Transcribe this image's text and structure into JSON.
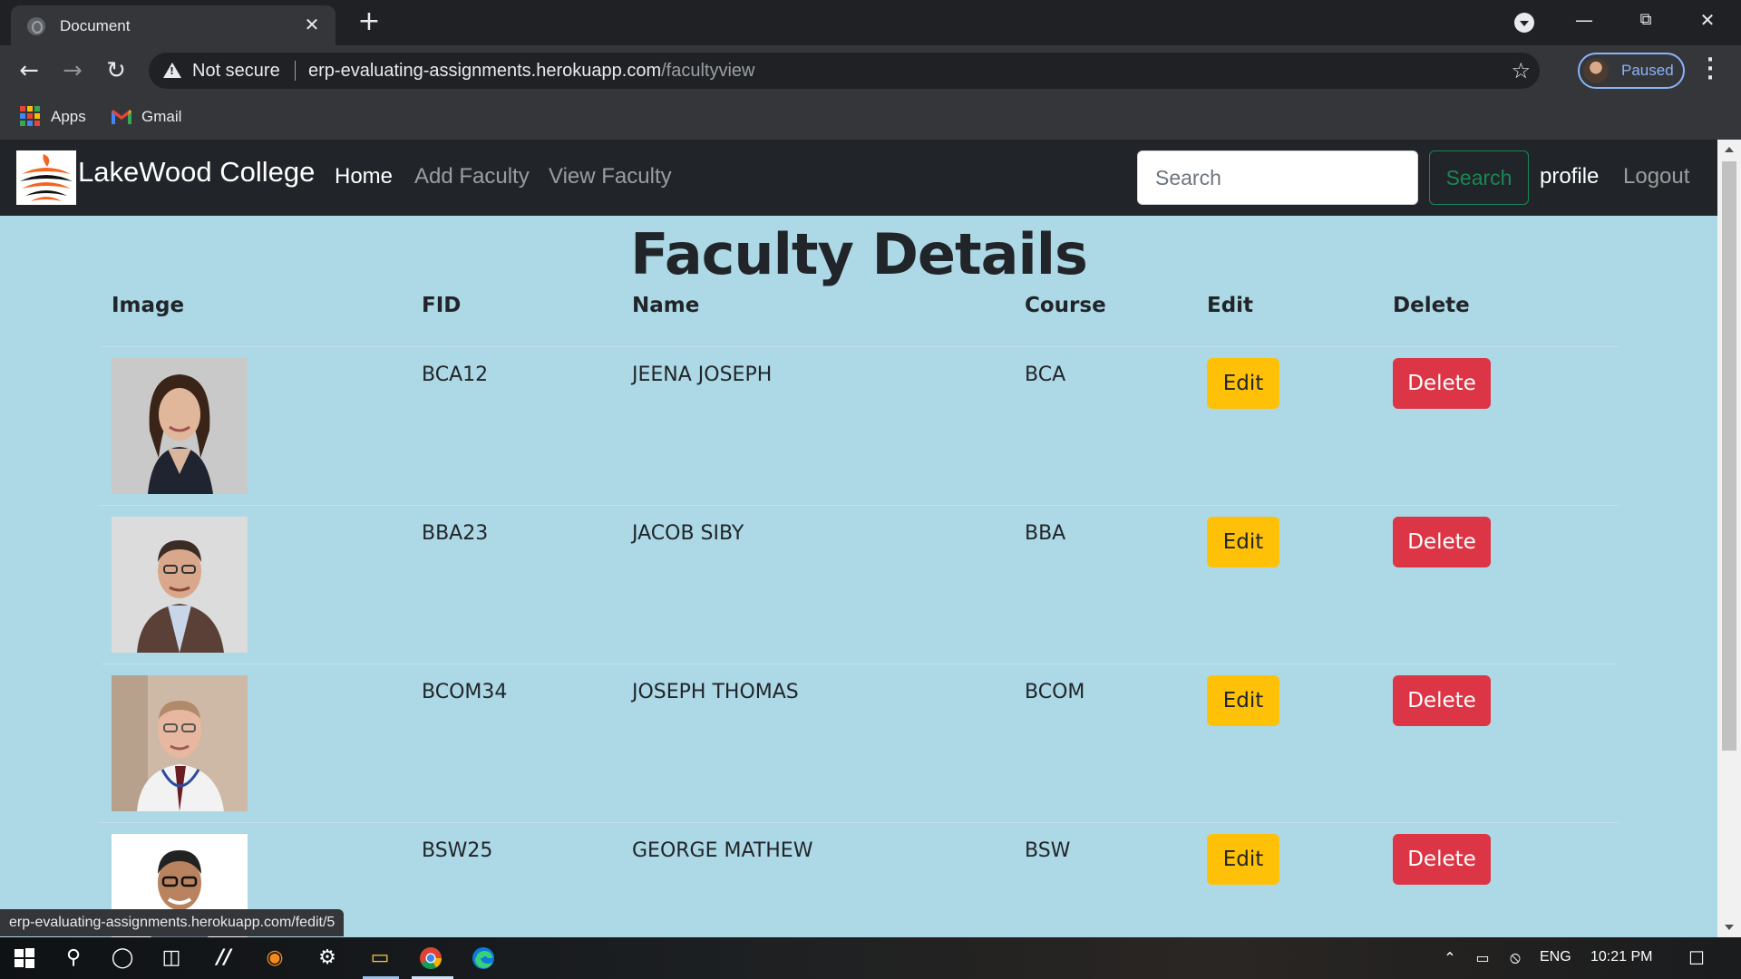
{
  "browser": {
    "tab_title": "Document",
    "tab_close": "✕",
    "new_tab": "+",
    "address": {
      "security_label": "Not secure",
      "url_host": "erp-evaluating-assignments.herokuapp.com",
      "url_path": "/facultyview"
    },
    "profile_label": "Paused",
    "bookmarks": [
      {
        "label": "Apps",
        "icon": "apps-grid-icon"
      },
      {
        "label": "Gmail",
        "icon": "gmail-icon"
      }
    ],
    "status_url": "erp-evaluating-assignments.herokuapp.com/fedit/5"
  },
  "navbar": {
    "brand": "LakeWood College",
    "links": [
      "Home",
      "Add Faculty",
      "View Faculty"
    ],
    "search_placeholder": "Search",
    "search_button": "Search",
    "profile": "profile",
    "logout": "Logout"
  },
  "page": {
    "title": "Faculty Details",
    "columns": [
      "Image",
      "FID",
      "Name",
      "Course",
      "Edit",
      "Delete"
    ],
    "rows": [
      {
        "fid": "BCA12",
        "name": "JEENA JOSEPH",
        "course": "BCA",
        "edit": "Edit",
        "delete": "Delete"
      },
      {
        "fid": "BBA23",
        "name": "JACOB SIBY",
        "course": "BBA",
        "edit": "Edit",
        "delete": "Delete"
      },
      {
        "fid": "BCOM34",
        "name": "JOSEPH THOMAS",
        "course": "BCOM",
        "edit": "Edit",
        "delete": "Delete"
      },
      {
        "fid": "BSW25",
        "name": "GEORGE MATHEW",
        "course": "BSW",
        "edit": "Edit",
        "delete": "Delete"
      }
    ]
  },
  "taskbar": {
    "language": "ENG",
    "time": "10:21 PM"
  },
  "colors": {
    "page_bg": "#add8e6",
    "navbar_bg": "#212529",
    "edit_btn": "#ffc107",
    "delete_btn": "#dc3545",
    "search_btn": "#198754"
  }
}
